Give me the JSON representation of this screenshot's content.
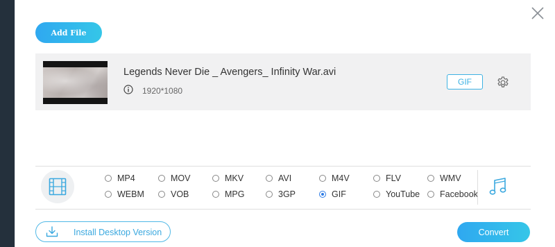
{
  "toolbar": {
    "add_file_label": "Add File"
  },
  "file": {
    "name": "Legends Never Die _ Avengers_ Infinity War.avi",
    "resolution": "1920*1080",
    "output_format": "GIF"
  },
  "formats": {
    "selected": "GIF",
    "row1": [
      "MP4",
      "MOV",
      "MKV",
      "AVI",
      "M4V",
      "FLV",
      "WMV"
    ],
    "row2": [
      "WEBM",
      "VOB",
      "MPG",
      "3GP",
      "GIF",
      "YouTube",
      "Facebook"
    ]
  },
  "footer": {
    "install_label": "Install Desktop Version",
    "convert_label": "Convert"
  },
  "icons": {
    "close": "close-icon",
    "info": "info-icon",
    "settings": "gear-icon",
    "video_tab": "film-icon",
    "audio_tab": "music-note-icon",
    "install": "download-icon"
  },
  "colors": {
    "accent": "#2fa8f0",
    "accent_light": "#35c6e8",
    "badge": "#3db2e3",
    "radio_selected": "#2d7be5"
  }
}
